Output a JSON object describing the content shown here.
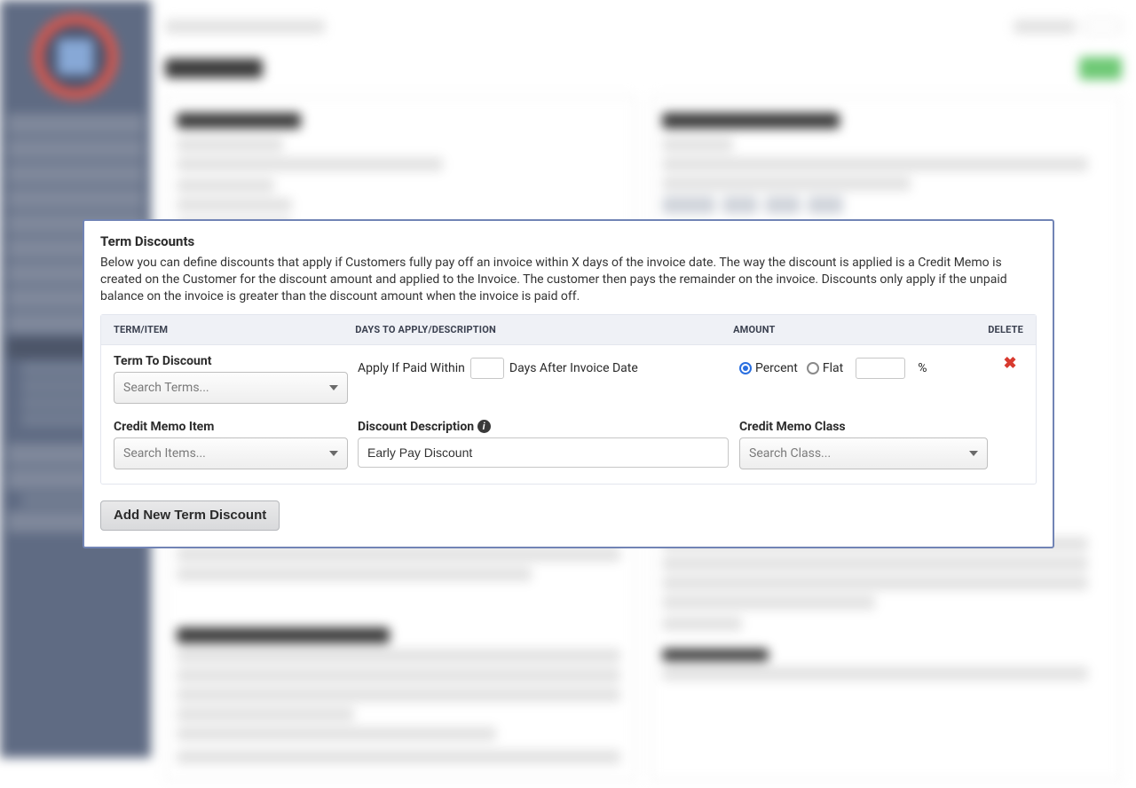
{
  "modal": {
    "title": "Term Discounts",
    "description": "Below you can define discounts that apply if Customers fully pay off an invoice within X days of the invoice date. The way the discount is applied is a Credit Memo is created on the Customer for the discount amount and applied to the Invoice. The customer then pays the remainder on the invoice. Discounts only apply if the unpaid balance on the invoice is greater than the discount amount when the invoice is paid off.",
    "headers": {
      "term": "TERM/ITEM",
      "days": "DAYS TO APPLY/DESCRIPTION",
      "amount": "AMOUNT",
      "delete": "DELETE"
    },
    "row": {
      "term_label": "Term To Discount",
      "term_placeholder": "Search Terms...",
      "apply_prefix": "Apply If Paid Within",
      "apply_suffix": "Days After Invoice Date",
      "days_value": "",
      "amount_type_percent_label": "Percent",
      "amount_type_flat_label": "Flat",
      "amount_type_selected": "percent",
      "amount_value": "",
      "amount_suffix": "%",
      "credit_memo_item_label": "Credit Memo Item",
      "credit_memo_item_placeholder": "Search Items...",
      "discount_description_label": "Discount Description",
      "discount_description_value": "Early Pay Discount",
      "credit_memo_class_label": "Credit Memo Class",
      "credit_memo_class_placeholder": "Search Class..."
    },
    "add_button_label": "Add New Term Discount"
  }
}
